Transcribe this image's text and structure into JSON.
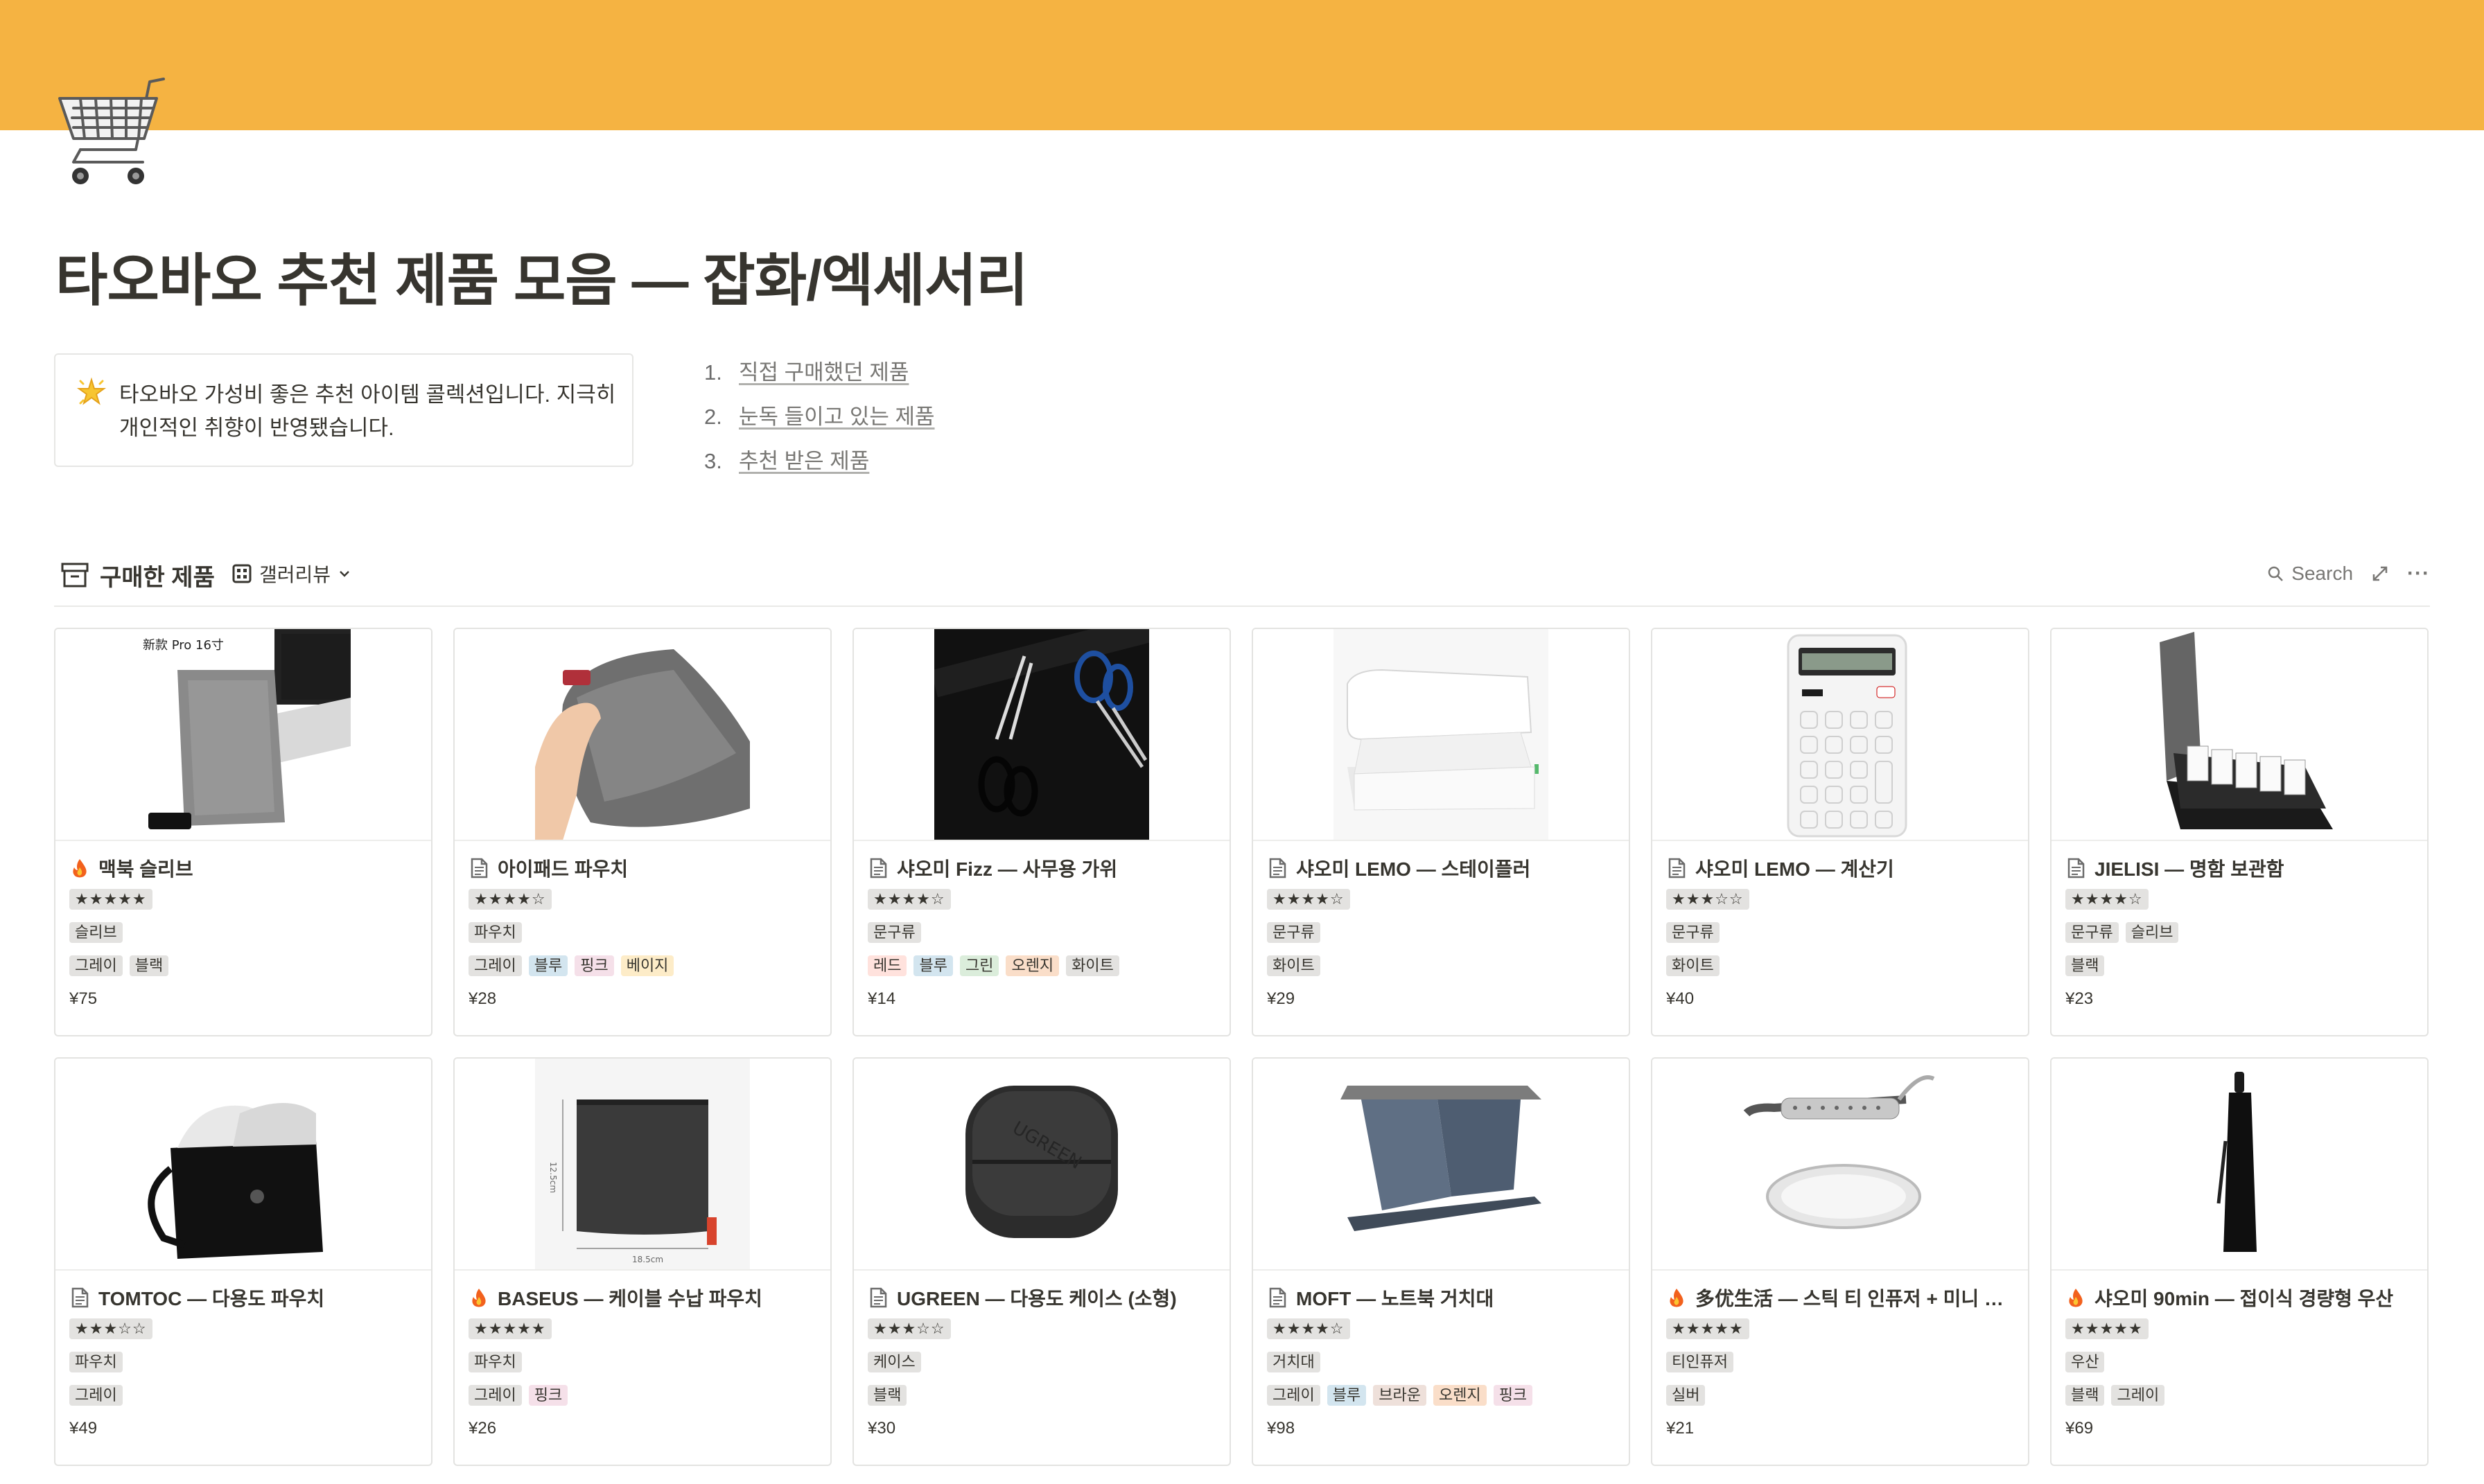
{
  "page": {
    "title": "타오바오 추천 제품 모음 — 잡화/엑세서리",
    "icon": "shopping-cart-icon",
    "cover_color": "#f5b342"
  },
  "callout": {
    "icon": "glowing-star-icon",
    "text": "타오바오 가성비 좋은 추천 아이템 콜렉션입니다. 지극히 개인적인 취향이 반영됐습니다."
  },
  "toc": [
    {
      "num": "1.",
      "label": "직접 구매했던 제품"
    },
    {
      "num": "2.",
      "label": "눈독 들이고 있는 제품"
    },
    {
      "num": "3.",
      "label": "추천 받은 제품"
    }
  ],
  "database": {
    "title": "구매한 제품",
    "view_label": "갤러리뷰",
    "search_label": "Search",
    "more_label": "···"
  },
  "tag_colors": {
    "gray": "#e3e2e0",
    "blue": "#d3e5ef",
    "pink": "#f5e0e9",
    "yellow": "#fdecc8",
    "red": "#ffe2dd",
    "green": "#dbeddb",
    "orange": "#fadec9",
    "brown": "#eee0da"
  },
  "cards": [
    {
      "title": "맥북 슬리브",
      "icon": "fire-icon",
      "rating": "★★★★★",
      "category": [
        "슬리브"
      ],
      "colors": [
        {
          "label": "그레이",
          "c": "gray"
        },
        {
          "label": "블랙",
          "c": "gray"
        }
      ],
      "price": "¥75",
      "image": "laptop-sleeve"
    },
    {
      "title": "아이패드 파우치",
      "icon": "page-icon",
      "rating": "★★★★☆",
      "category": [
        "파우치"
      ],
      "colors": [
        {
          "label": "그레이",
          "c": "gray"
        },
        {
          "label": "블루",
          "c": "blue"
        },
        {
          "label": "핑크",
          "c": "pink"
        },
        {
          "label": "베이지",
          "c": "yellow"
        }
      ],
      "price": "¥28",
      "image": "ipad-pouch"
    },
    {
      "title": "샤오미 Fizz — 사무용 가위",
      "icon": "page-icon",
      "rating": "★★★★☆",
      "category": [
        "문구류"
      ],
      "colors": [
        {
          "label": "레드",
          "c": "red"
        },
        {
          "label": "블루",
          "c": "blue"
        },
        {
          "label": "그린",
          "c": "green"
        },
        {
          "label": "오렌지",
          "c": "orange"
        },
        {
          "label": "화이트",
          "c": "gray"
        }
      ],
      "price": "¥14",
      "image": "scissors"
    },
    {
      "title": "샤오미 LEMO — 스테이플러",
      "icon": "page-icon",
      "rating": "★★★★☆",
      "category": [
        "문구류"
      ],
      "colors": [
        {
          "label": "화이트",
          "c": "gray"
        }
      ],
      "price": "¥29",
      "image": "stapler"
    },
    {
      "title": "샤오미 LEMO — 계산기",
      "icon": "page-icon",
      "rating": "★★★☆☆",
      "category": [
        "문구류"
      ],
      "colors": [
        {
          "label": "화이트",
          "c": "gray"
        }
      ],
      "price": "¥40",
      "image": "calculator"
    },
    {
      "title": "JIELISI — 명함 보관함",
      "icon": "page-icon",
      "rating": "★★★★☆",
      "category": [
        "문구류",
        "슬리브"
      ],
      "colors": [
        {
          "label": "블랙",
          "c": "gray"
        }
      ],
      "price": "¥23",
      "image": "card-box"
    },
    {
      "title": "TOMTOC — 다용도 파우치",
      "icon": "page-icon",
      "rating": "★★★☆☆",
      "category": [
        "파우치"
      ],
      "colors": [
        {
          "label": "그레이",
          "c": "gray"
        }
      ],
      "price": "¥49",
      "image": "tomtoc-pouch"
    },
    {
      "title": "BASEUS — 케이블 수납 파우치",
      "icon": "fire-icon",
      "rating": "★★★★★",
      "category": [
        "파우치"
      ],
      "colors": [
        {
          "label": "그레이",
          "c": "gray"
        },
        {
          "label": "핑크",
          "c": "pink"
        }
      ],
      "price": "¥26",
      "image": "cable-pouch"
    },
    {
      "title": "UGREEN — 다용도 케이스 (소형)",
      "icon": "page-icon",
      "rating": "★★★☆☆",
      "category": [
        "케이스"
      ],
      "colors": [
        {
          "label": "블랙",
          "c": "gray"
        }
      ],
      "price": "¥30",
      "image": "hard-case"
    },
    {
      "title": "MOFT — 노트북 거치대",
      "icon": "page-icon",
      "rating": "★★★★☆",
      "category": [
        "거치대"
      ],
      "colors": [
        {
          "label": "그레이",
          "c": "gray"
        },
        {
          "label": "블루",
          "c": "blue"
        },
        {
          "label": "브라운",
          "c": "brown"
        },
        {
          "label": "오렌지",
          "c": "orange"
        },
        {
          "label": "핑크",
          "c": "pink"
        }
      ],
      "price": "¥98",
      "image": "laptop-stand"
    },
    {
      "title": "多优生活 — 스틱 티 인퓨저 + 미니 트...",
      "icon": "fire-icon",
      "rating": "★★★★★",
      "category": [
        "티인퓨저"
      ],
      "colors": [
        {
          "label": "실버",
          "c": "gray"
        }
      ],
      "price": "¥21",
      "image": "tea-infuser"
    },
    {
      "title": "샤오미 90min — 접이식 경량형 우산",
      "icon": "fire-icon",
      "rating": "★★★★★",
      "category": [
        "우산"
      ],
      "colors": [
        {
          "label": "블랙",
          "c": "gray"
        },
        {
          "label": "그레이",
          "c": "gray"
        }
      ],
      "price": "¥69",
      "image": "umbrella"
    }
  ]
}
